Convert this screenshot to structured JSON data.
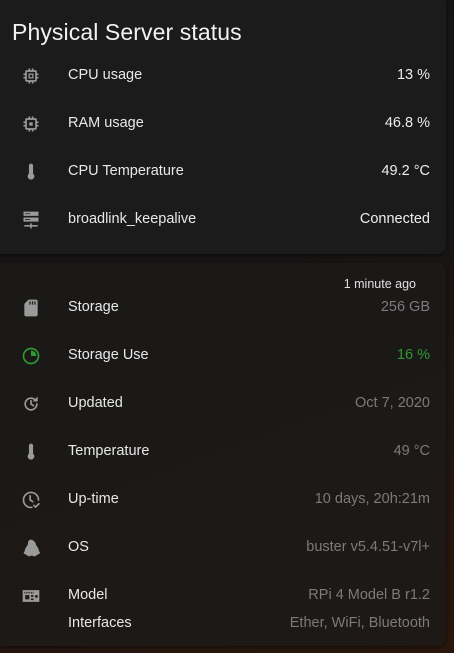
{
  "physical": {
    "title": "Physical Server status",
    "rows": [
      {
        "icon": "cpu-chip-icon",
        "label": "CPU usage",
        "value": "13 %"
      },
      {
        "icon": "memory-chip-icon",
        "label": "RAM usage",
        "value": "46.8 %"
      },
      {
        "icon": "thermometer-icon",
        "label": "CPU Temperature",
        "value": "49.2 °C"
      },
      {
        "icon": "server-network-icon",
        "label": "broadlink_keepalive",
        "value": "Connected"
      }
    ]
  },
  "pi": {
    "updated_ago": "1 minute ago",
    "rows": [
      {
        "icon": "sd-card-icon",
        "label": "Storage",
        "value": "256 GB"
      },
      {
        "icon": "pie-chart-icon",
        "label": "Storage Use",
        "value": "16 %",
        "value_color": "#2f9a30"
      },
      {
        "icon": "refresh-clock-icon",
        "label": "Updated",
        "value": "Oct 7, 2020"
      },
      {
        "icon": "thermometer-icon",
        "label": "Temperature",
        "value": "49 °C"
      },
      {
        "icon": "clock-check-icon",
        "label": "Up-time",
        "value": "10 days, 20h:21m"
      },
      {
        "icon": "linux-penguin-icon",
        "label": "OS",
        "value": "buster v5.4.51-v7l+"
      },
      {
        "icon": "raspberry-pi-board-icon",
        "label": "Model",
        "value": "RPi 4 Model B r1.2"
      }
    ],
    "interfaces": {
      "label": "Interfaces",
      "value": "Ether, WiFi, Bluetooth"
    }
  },
  "colors": {
    "accent_green": "#2f9a30",
    "icon_gray": "#9a9a9a",
    "secondary_text": "#7b7b7b"
  }
}
